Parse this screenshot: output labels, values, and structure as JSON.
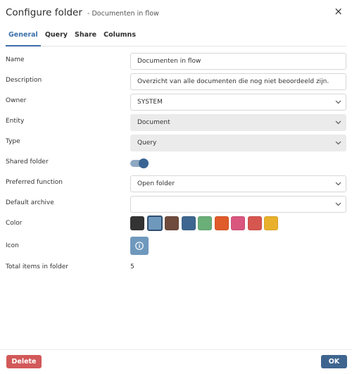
{
  "dialog": {
    "title": "Configure folder",
    "subtitle": "- Documenten in flow",
    "close_glyph": "×"
  },
  "tabs": [
    {
      "label": "General",
      "active": true
    },
    {
      "label": "Query",
      "active": false
    },
    {
      "label": "Share",
      "active": false
    },
    {
      "label": "Columns",
      "active": false
    }
  ],
  "form": {
    "name": {
      "label": "Name",
      "value": "Documenten in flow"
    },
    "description": {
      "label": "Description",
      "value": "Overzicht van alle documenten die nog niet beoordeeld zijn."
    },
    "owner": {
      "label": "Owner",
      "value": "SYSTEM"
    },
    "entity": {
      "label": "Entity",
      "value": "Document"
    },
    "type": {
      "label": "Type",
      "value": "Query"
    },
    "shared_folder": {
      "label": "Shared folder",
      "on": true
    },
    "preferred_function": {
      "label": "Preferred function",
      "value": "Open folder"
    },
    "default_archive": {
      "label": "Default archive",
      "value": ""
    },
    "color": {
      "label": "Color",
      "selected": 1,
      "options": [
        "#333333",
        "#6f98bd",
        "#6e4b3d",
        "#3f6690",
        "#6aae78",
        "#e05a2a",
        "#d9567f",
        "#d65650",
        "#e9b02c"
      ]
    },
    "icon": {
      "label": "Icon",
      "icon_name": "info-circle-icon"
    },
    "total_items": {
      "label": "Total items in folder",
      "value": "5"
    }
  },
  "footer": {
    "delete_label": "Delete",
    "ok_label": "OK"
  },
  "colors": {
    "accent": "#3a6fa8",
    "delete": "#d25959",
    "ok": "#3f658f"
  }
}
